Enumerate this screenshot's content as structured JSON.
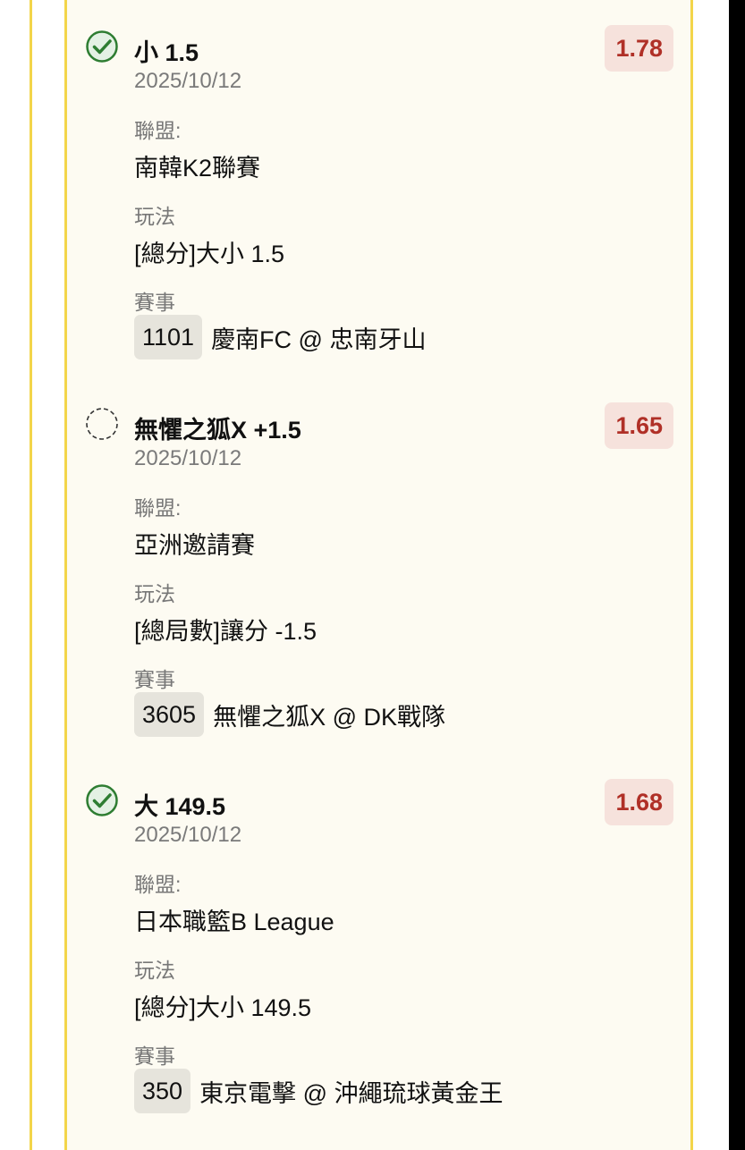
{
  "colors": {
    "accent_border": "#f3d54a",
    "odds_text": "#b03027",
    "odds_bg": "#f6e2dc",
    "win_icon": "#2e7d32",
    "card_bg": "#fdfbf2"
  },
  "bets": [
    {
      "status_icon": "check-circle-icon",
      "selection": "小 1.5",
      "odds": "1.78",
      "date": "2025/10/12",
      "league_label": "聯盟:",
      "league": "南韓K2聯賽",
      "market_label": "玩法",
      "market": "[總分]大小 1.5",
      "event_label": "賽事",
      "event_id": "1101",
      "event_name": "慶南FC @ 忠南牙山"
    },
    {
      "status_icon": "pending-circle-icon",
      "selection": "無懼之狐X +1.5",
      "odds": "1.65",
      "date": "2025/10/12",
      "league_label": "聯盟:",
      "league": "亞洲邀請賽",
      "market_label": "玩法",
      "market": "[總局數]讓分 -1.5",
      "event_label": "賽事",
      "event_id": "3605",
      "event_name": "無懼之狐X @ DK戰隊"
    },
    {
      "status_icon": "check-circle-icon",
      "selection": "大 149.5",
      "odds": "1.68",
      "date": "2025/10/12",
      "league_label": "聯盟:",
      "league": "日本職籃B League",
      "market_label": "玩法",
      "market": "[總分]大小 149.5",
      "event_label": "賽事",
      "event_id": "350",
      "event_name": "東京電擊 @ 沖繩琉球黃金王"
    }
  ]
}
